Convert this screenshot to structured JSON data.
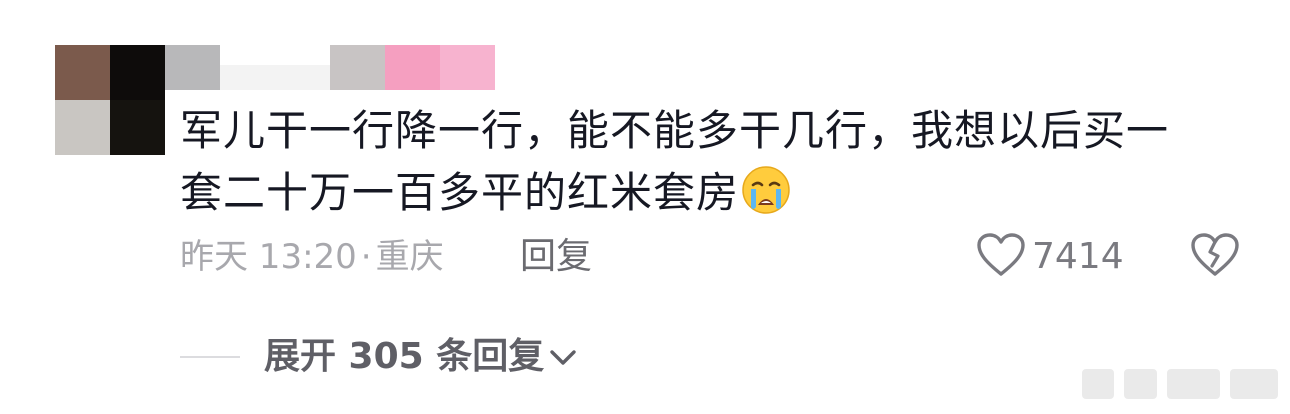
{
  "comment": {
    "text_line1": "军儿干一行降一行，能不能多干几行，我想以后买一",
    "text_line2": "套二十万一百多平的红米套房",
    "emoji": "loudly-crying-face",
    "timestamp": "昨天 13:20",
    "separator": "·",
    "location": "重庆",
    "reply_label": "回复",
    "like_count": "7414",
    "expand_replies_label": "展开 305 条回复"
  },
  "colors": {
    "text_primary": "#161823",
    "text_meta": "#a8a8ad",
    "text_action": "#6b6b70",
    "avatar_tile_1": "#7b5a4c",
    "avatar_tile_2": "#0e0c0b",
    "avatar_tile_3": "#c9c6c2",
    "avatar_tile_4": "#15130f",
    "username_pink": "#f59fc0"
  },
  "icons": {
    "like": "heart-outline-icon",
    "dislike": "broken-heart-outline-icon",
    "expand": "chevron-down-icon",
    "emoji": "crying-face-icon"
  }
}
